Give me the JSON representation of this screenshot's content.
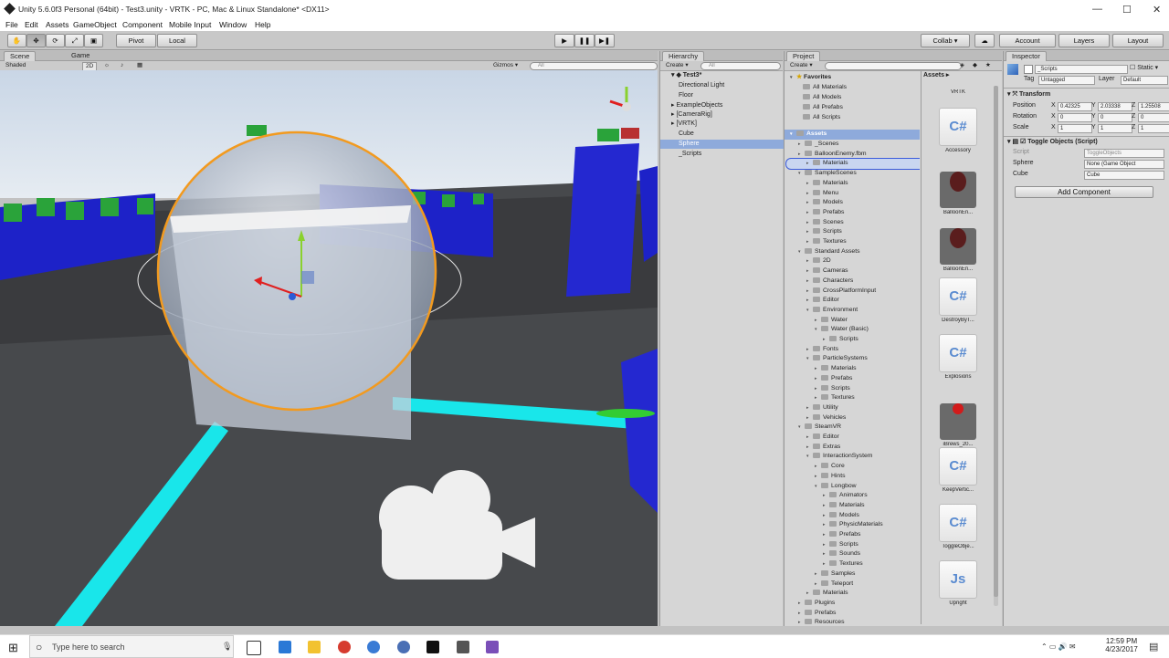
{
  "window": {
    "title": "Unity 5.6.0f3 Personal (64bit) - Test3.unity - VRTK - PC, Mac & Linux Standalone* <DX11>"
  },
  "menu": [
    "File",
    "Edit",
    "Assets",
    "GameObject",
    "Component",
    "Mobile Input",
    "Window",
    "Help"
  ],
  "toolbar": {
    "pivot": "Pivot",
    "local": "Local",
    "collab": "Collab ▾",
    "account": "Account",
    "layers": "Layers",
    "layout": "Layout"
  },
  "scene": {
    "tab_scene": "Scene",
    "tab_game": "Game",
    "shading": "Shaded",
    "mode2d": "2D",
    "gizmos": "Gizmos ▾",
    "search_placeholder": "All",
    "persp": "Persp"
  },
  "hierarchy": {
    "tab": "Hierarchy",
    "create": "Create ▾",
    "search_placeholder": "All",
    "scene_name": "Test3*",
    "items": [
      "Directional Light",
      "Floor",
      "ExampleObjects",
      "[CameraRig]",
      "[VRTK]",
      "Cube",
      "Sphere",
      "_Scripts"
    ]
  },
  "project": {
    "tab": "Project",
    "create": "Create ▾",
    "favorites_label": "Favorites",
    "favorites": [
      "All Materials",
      "All Models",
      "All Prefabs",
      "All Scripts"
    ],
    "assets_label": "Assets",
    "tree": [
      {
        "name": "_Scenes",
        "lv": 1
      },
      {
        "name": "BalloonEnemy.fbm",
        "lv": 1
      },
      {
        "name": "Materials",
        "lv": 1
      },
      {
        "name": "SampleScenes",
        "lv": 1,
        "open": true
      },
      {
        "name": "Materials",
        "lv": 2
      },
      {
        "name": "Menu",
        "lv": 2
      },
      {
        "name": "Models",
        "lv": 2
      },
      {
        "name": "Prefabs",
        "lv": 2
      },
      {
        "name": "Scenes",
        "lv": 2
      },
      {
        "name": "Scripts",
        "lv": 2
      },
      {
        "name": "Textures",
        "lv": 2
      },
      {
        "name": "Standard Assets",
        "lv": 1,
        "open": true
      },
      {
        "name": "2D",
        "lv": 2
      },
      {
        "name": "Cameras",
        "lv": 2
      },
      {
        "name": "Characters",
        "lv": 2
      },
      {
        "name": "CrossPlatformInput",
        "lv": 2
      },
      {
        "name": "Editor",
        "lv": 2
      },
      {
        "name": "Environment",
        "lv": 2,
        "open": true
      },
      {
        "name": "Water",
        "lv": 3
      },
      {
        "name": "Water (Basic)",
        "lv": 3,
        "open": true
      },
      {
        "name": "Scripts",
        "lv": 4
      },
      {
        "name": "Fonts",
        "lv": 2
      },
      {
        "name": "ParticleSystems",
        "lv": 2,
        "open": true
      },
      {
        "name": "Materials",
        "lv": 3
      },
      {
        "name": "Prefabs",
        "lv": 3
      },
      {
        "name": "Scripts",
        "lv": 3
      },
      {
        "name": "Textures",
        "lv": 3
      },
      {
        "name": "Utility",
        "lv": 2
      },
      {
        "name": "Vehicles",
        "lv": 2
      },
      {
        "name": "SteamVR",
        "lv": 1,
        "open": true
      },
      {
        "name": "Editor",
        "lv": 2
      },
      {
        "name": "Extras",
        "lv": 2
      },
      {
        "name": "InteractionSystem",
        "lv": 2,
        "open": true
      },
      {
        "name": "Core",
        "lv": 3
      },
      {
        "name": "Hints",
        "lv": 3
      },
      {
        "name": "Longbow",
        "lv": 3,
        "open": true
      },
      {
        "name": "Animators",
        "lv": 4
      },
      {
        "name": "Materials",
        "lv": 4
      },
      {
        "name": "Models",
        "lv": 4
      },
      {
        "name": "PhysicMaterials",
        "lv": 4
      },
      {
        "name": "Prefabs",
        "lv": 4
      },
      {
        "name": "Scripts",
        "lv": 4
      },
      {
        "name": "Sounds",
        "lv": 4
      },
      {
        "name": "Textures",
        "lv": 4
      },
      {
        "name": "Samples",
        "lv": 3
      },
      {
        "name": "Teleport",
        "lv": 3
      },
      {
        "name": "Materials",
        "lv": 2
      },
      {
        "name": "Plugins",
        "lv": 1
      },
      {
        "name": "Prefabs",
        "lv": 1
      },
      {
        "name": "Resources",
        "lv": 1
      }
    ],
    "breadcrumb": "Assets ▸",
    "grid": [
      {
        "name": "VRTK",
        "kind": "folder"
      },
      {
        "name": "Accessory",
        "kind": "cs"
      },
      {
        "name": "BalloonEn...",
        "kind": "model"
      },
      {
        "name": "BalloonEn...",
        "kind": "model"
      },
      {
        "name": "DestroyByT...",
        "kind": "cs"
      },
      {
        "name": "Explosions",
        "kind": "cs"
      },
      {
        "name": "iBrews_20...",
        "kind": "red"
      },
      {
        "name": "KeepVertic...",
        "kind": "cs"
      },
      {
        "name": "ToggleObje...",
        "kind": "cs"
      },
      {
        "name": "Upright",
        "kind": "js"
      }
    ]
  },
  "inspector": {
    "tab": "Inspector",
    "object_name": "_Scripts",
    "static_label": "Static ▾",
    "tag_label": "Tag",
    "tag_value": "Untagged",
    "layer_label": "Layer",
    "layer_value": "Default",
    "transform_label": "Transform",
    "position_label": "Position",
    "rotation_label": "Rotation",
    "scale_label": "Scale",
    "position": [
      "0.42325",
      "2.03338",
      "1.25508"
    ],
    "rotation": [
      "0",
      "0",
      "0"
    ],
    "scale": [
      "1",
      "1",
      "1"
    ],
    "x": "X",
    "y": "Y",
    "z": "Z",
    "component_label": "Toggle Objects (Script)",
    "script_label": "Script",
    "script_value": "ToggleObjects",
    "sphere_label": "Sphere",
    "sphere_value": "None (Game Object",
    "cube_label": "Cube",
    "cube_value": "Cube",
    "add_component": "Add Component"
  },
  "taskbar": {
    "search_placeholder": "Type here to search",
    "time": "12:59 PM",
    "date": "4/23/2017"
  }
}
